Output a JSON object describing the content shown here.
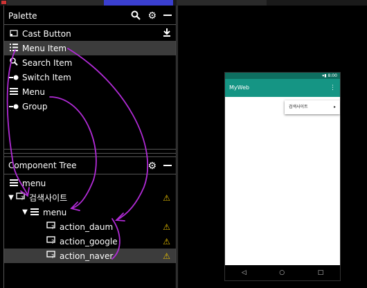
{
  "palette": {
    "title": "Palette",
    "items": [
      {
        "label": "Cast Button",
        "icon": "cast-icon",
        "glyph": "⊏"
      },
      {
        "label": "Menu Item",
        "icon": "list-icon",
        "glyph": "☷"
      },
      {
        "label": "Search Item",
        "icon": "search-icon",
        "glyph": "⚲"
      },
      {
        "label": "Switch Item",
        "icon": "switch-icon",
        "glyph": "•●"
      },
      {
        "label": "Menu",
        "icon": "menu-icon",
        "glyph": "☰"
      },
      {
        "label": "Group",
        "icon": "group-icon",
        "glyph": "•●"
      }
    ]
  },
  "tree": {
    "title": "Component Tree",
    "nodes": [
      {
        "label": "menu"
      },
      {
        "label": "검색사이트"
      },
      {
        "label": "menu"
      },
      {
        "label": "action_daum"
      },
      {
        "label": "action_google"
      },
      {
        "label": "action_naver"
      }
    ]
  },
  "device": {
    "status_time": "8:00",
    "app_title": "MyWeb",
    "overflow": "⋮",
    "popup_item": "검색사이트",
    "popup_chevron": "▸",
    "nav_back": "◁",
    "nav_home": "○",
    "nav_recent": "□"
  },
  "colors": {
    "status_bar": "#0e6e60",
    "app_bar": "#159584",
    "warning": "#e8c000",
    "annotation": "#b12bd6"
  }
}
